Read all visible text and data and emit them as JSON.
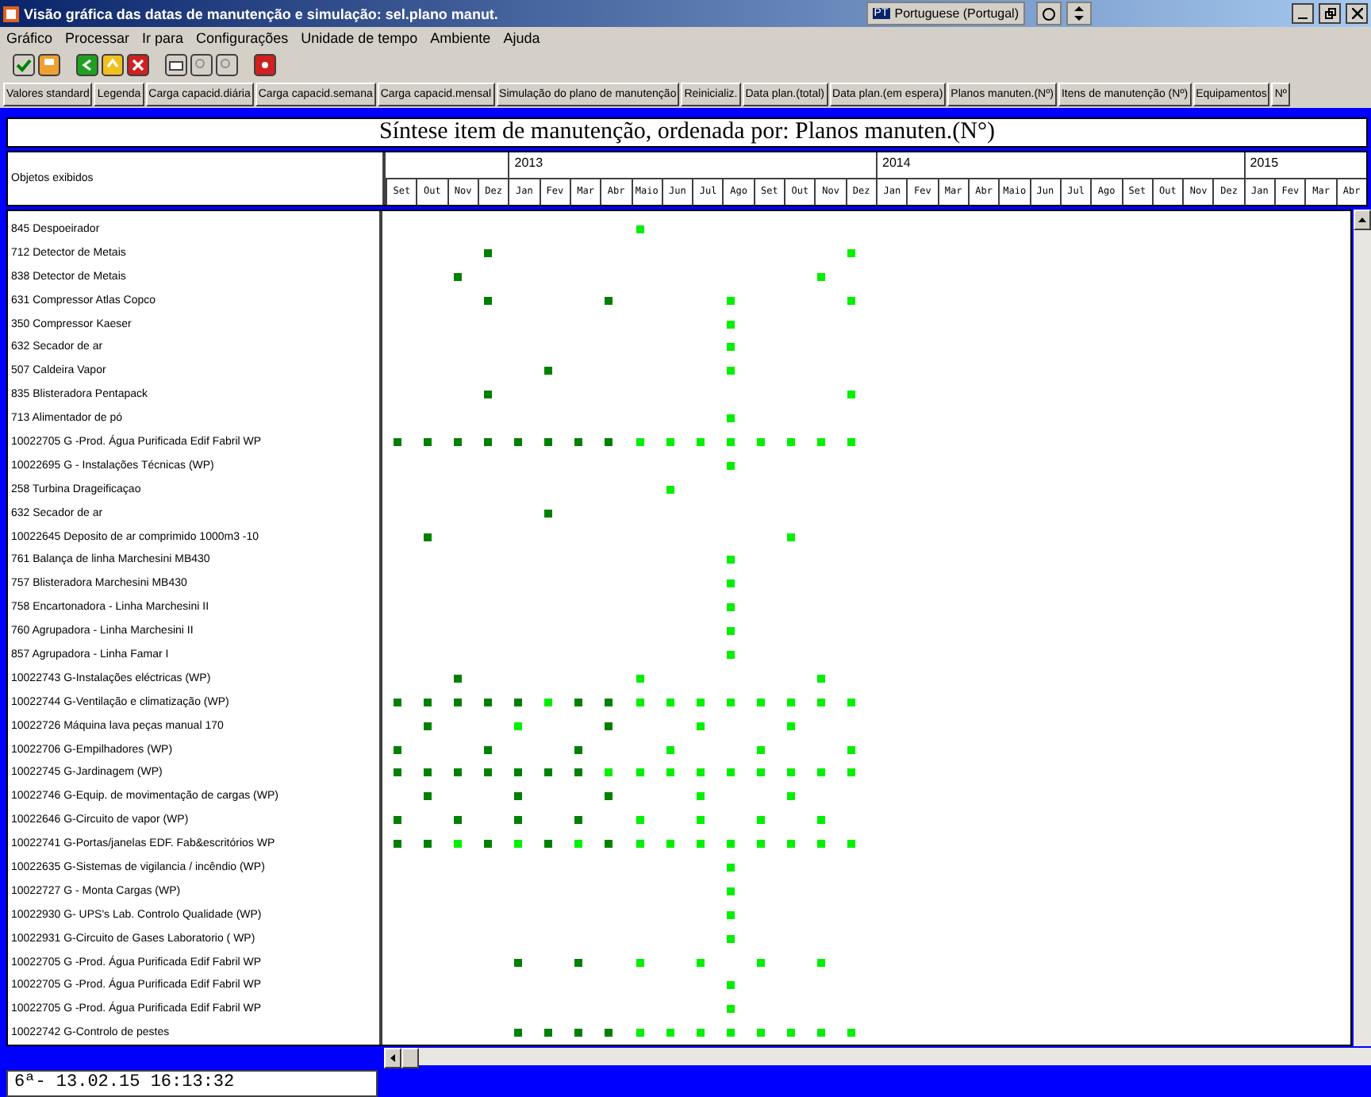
{
  "window": {
    "title": "Visão gráfica das datas de manutenção e simulação: sel.plano manut.",
    "language": "Portuguese (Portugal)",
    "language_code": "PT"
  },
  "menu": [
    "Gráfico",
    "Processar",
    "Ir para",
    "Configurações",
    "Unidade de tempo",
    "Ambiente",
    "Ajuda"
  ],
  "buttons": [
    "Valores standard",
    "Legenda",
    "Carga capacid.diária",
    "Carga capacid.semana",
    "Carga capacid.mensal",
    "Simulação do plano de manutenção",
    "Reinicializ.",
    "Data plan.(total)",
    "Data plan.(em espera)",
    "Planos manuten.(Nº)",
    "Itens de manutenção (Nº)",
    "Equipamentos",
    "Nº"
  ],
  "chart_title": "Síntese item de manutenção, ordenada por: Planos manuten.(N°)",
  "list_header": "Objetos exibidos",
  "years": [
    "2013",
    "2014",
    "2015"
  ],
  "months": [
    "Set",
    "Out",
    "Nov",
    "Dez",
    "Jan",
    "Fev",
    "Mar",
    "Abr",
    "Maio",
    "Jun",
    "Jul",
    "Ago",
    "Set",
    "Out",
    "Nov",
    "Dez",
    "Jan",
    "Fev",
    "Mar",
    "Abr",
    "Maio",
    "Jun",
    "Jul",
    "Ago",
    "Set",
    "Out",
    "Nov",
    "Dez",
    "Jan",
    "Fev",
    "Mar",
    "Abr"
  ],
  "rows": [
    {
      "name": "845 Despoeirador",
      "slots": [
        {
          "kind": "none"
        },
        {
          "kind": "none"
        },
        {
          "kind": "none"
        },
        {
          "kind": "none"
        },
        {
          "kind": "none"
        },
        {
          "kind": "none"
        },
        {
          "kind": "none"
        },
        {
          "kind": "none"
        },
        {
          "kind": "light"
        },
        {
          "kind": "none"
        },
        {
          "kind": "none"
        },
        {
          "kind": "none"
        },
        {
          "kind": "none"
        },
        {
          "kind": "none"
        },
        {
          "kind": "none"
        },
        {
          "kind": "none"
        }
      ]
    },
    {
      "name": "712 Detector de Metais",
      "slots": [
        {
          "kind": "none"
        },
        {
          "kind": "none"
        },
        {
          "kind": "none"
        },
        {
          "kind": "dark"
        },
        {
          "kind": "none"
        },
        {
          "kind": "none"
        },
        {
          "kind": "none"
        },
        {
          "kind": "none"
        },
        {
          "kind": "none"
        },
        {
          "kind": "none"
        },
        {
          "kind": "none"
        },
        {
          "kind": "none"
        },
        {
          "kind": "none"
        },
        {
          "kind": "none"
        },
        {
          "kind": "none"
        },
        {
          "kind": "light"
        }
      ]
    },
    {
      "name": "838 Detector de Metais",
      "slots": [
        {
          "kind": "none"
        },
        {
          "kind": "none"
        },
        {
          "kind": "dark"
        },
        {
          "kind": "none"
        },
        {
          "kind": "none"
        },
        {
          "kind": "none"
        },
        {
          "kind": "none"
        },
        {
          "kind": "none"
        },
        {
          "kind": "none"
        },
        {
          "kind": "none"
        },
        {
          "kind": "none"
        },
        {
          "kind": "none"
        },
        {
          "kind": "none"
        },
        {
          "kind": "none"
        },
        {
          "kind": "light"
        },
        {
          "kind": "none"
        }
      ]
    },
    {
      "name": "631 Compressor Atlas Copco",
      "slots": [
        {
          "kind": "none"
        },
        {
          "kind": "none"
        },
        {
          "kind": "none"
        },
        {
          "kind": "dark"
        },
        {
          "kind": "none"
        },
        {
          "kind": "none"
        },
        {
          "kind": "none"
        },
        {
          "kind": "dark"
        },
        {
          "kind": "none"
        },
        {
          "kind": "none"
        },
        {
          "kind": "none"
        },
        {
          "kind": "light"
        },
        {
          "kind": "none"
        },
        {
          "kind": "none"
        },
        {
          "kind": "none"
        },
        {
          "kind": "light"
        }
      ]
    },
    {
      "name": "350 Compressor Kaeser",
      "slots": [
        {
          "kind": "none"
        },
        {
          "kind": "none"
        },
        {
          "kind": "none"
        },
        {
          "kind": "none"
        },
        {
          "kind": "none"
        },
        {
          "kind": "none"
        },
        {
          "kind": "none"
        },
        {
          "kind": "none"
        },
        {
          "kind": "none"
        },
        {
          "kind": "none"
        },
        {
          "kind": "none"
        },
        {
          "kind": "light"
        },
        {
          "kind": "none"
        },
        {
          "kind": "none"
        },
        {
          "kind": "none"
        },
        {
          "kind": "none"
        }
      ]
    },
    {
      "name": "632 Secador de ar",
      "slots": [
        {
          "kind": "none"
        },
        {
          "kind": "none"
        },
        {
          "kind": "none"
        },
        {
          "kind": "none"
        },
        {
          "kind": "none"
        },
        {
          "kind": "none"
        },
        {
          "kind": "none"
        },
        {
          "kind": "none"
        },
        {
          "kind": "none"
        },
        {
          "kind": "none"
        },
        {
          "kind": "none"
        },
        {
          "kind": "light"
        },
        {
          "kind": "none"
        },
        {
          "kind": "none"
        },
        {
          "kind": "none"
        },
        {
          "kind": "none"
        }
      ]
    },
    {
      "name": "507 Caldeira Vapor",
      "slots": [
        {
          "kind": "none"
        },
        {
          "kind": "none"
        },
        {
          "kind": "none"
        },
        {
          "kind": "none"
        },
        {
          "kind": "none"
        },
        {
          "kind": "dark"
        },
        {
          "kind": "none"
        },
        {
          "kind": "none"
        },
        {
          "kind": "none"
        },
        {
          "kind": "none"
        },
        {
          "kind": "none"
        },
        {
          "kind": "light"
        },
        {
          "kind": "none"
        },
        {
          "kind": "none"
        },
        {
          "kind": "none"
        },
        {
          "kind": "none"
        }
      ]
    },
    {
      "name": "835 Blisteradora Pentapack",
      "slots": [
        {
          "kind": "none"
        },
        {
          "kind": "none"
        },
        {
          "kind": "none"
        },
        {
          "kind": "dark"
        },
        {
          "kind": "none"
        },
        {
          "kind": "none"
        },
        {
          "kind": "none"
        },
        {
          "kind": "none"
        },
        {
          "kind": "none"
        },
        {
          "kind": "none"
        },
        {
          "kind": "none"
        },
        {
          "kind": "none"
        },
        {
          "kind": "none"
        },
        {
          "kind": "none"
        },
        {
          "kind": "none"
        },
        {
          "kind": "light"
        }
      ]
    },
    {
      "name": "713 Alimentador de pó",
      "slots": [
        {
          "kind": "none"
        },
        {
          "kind": "none"
        },
        {
          "kind": "none"
        },
        {
          "kind": "none"
        },
        {
          "kind": "none"
        },
        {
          "kind": "none"
        },
        {
          "kind": "none"
        },
        {
          "kind": "none"
        },
        {
          "kind": "none"
        },
        {
          "kind": "none"
        },
        {
          "kind": "none"
        },
        {
          "kind": "light"
        },
        {
          "kind": "none"
        },
        {
          "kind": "none"
        },
        {
          "kind": "none"
        },
        {
          "kind": "none"
        }
      ]
    },
    {
      "name": "10022705 G -Prod. Água Purificada Edif Fabril WP",
      "slots": [
        {
          "kind": "dark"
        },
        {
          "kind": "dark"
        },
        {
          "kind": "dark"
        },
        {
          "kind": "dark"
        },
        {
          "kind": "dark"
        },
        {
          "kind": "dark"
        },
        {
          "kind": "dark"
        },
        {
          "kind": "dark"
        },
        {
          "kind": "light"
        },
        {
          "kind": "light"
        },
        {
          "kind": "light"
        },
        {
          "kind": "light"
        },
        {
          "kind": "light"
        },
        {
          "kind": "light"
        },
        {
          "kind": "light"
        },
        {
          "kind": "light"
        }
      ]
    },
    {
      "name": "10022695 G - Instalações Técnicas (WP)",
      "slots": [
        {
          "kind": "none"
        },
        {
          "kind": "none"
        },
        {
          "kind": "none"
        },
        {
          "kind": "none"
        },
        {
          "kind": "none"
        },
        {
          "kind": "none"
        },
        {
          "kind": "none"
        },
        {
          "kind": "none"
        },
        {
          "kind": "none"
        },
        {
          "kind": "none"
        },
        {
          "kind": "none"
        },
        {
          "kind": "light"
        },
        {
          "kind": "none"
        },
        {
          "kind": "none"
        },
        {
          "kind": "none"
        },
        {
          "kind": "none"
        }
      ]
    },
    {
      "name": "258 Turbina Drageificaçao",
      "slots": [
        {
          "kind": "none"
        },
        {
          "kind": "none"
        },
        {
          "kind": "none"
        },
        {
          "kind": "none"
        },
        {
          "kind": "none"
        },
        {
          "kind": "none"
        },
        {
          "kind": "none"
        },
        {
          "kind": "none"
        },
        {
          "kind": "none"
        },
        {
          "kind": "light"
        },
        {
          "kind": "none"
        },
        {
          "kind": "none"
        },
        {
          "kind": "none"
        },
        {
          "kind": "none"
        },
        {
          "kind": "none"
        },
        {
          "kind": "none"
        }
      ]
    },
    {
      "name": "632 Secador de ar",
      "slots": [
        {
          "kind": "none"
        },
        {
          "kind": "none"
        },
        {
          "kind": "none"
        },
        {
          "kind": "none"
        },
        {
          "kind": "none"
        },
        {
          "kind": "dark"
        },
        {
          "kind": "none"
        },
        {
          "kind": "none"
        },
        {
          "kind": "none"
        },
        {
          "kind": "none"
        },
        {
          "kind": "none"
        },
        {
          "kind": "none"
        },
        {
          "kind": "none"
        },
        {
          "kind": "none"
        },
        {
          "kind": "none"
        },
        {
          "kind": "none"
        }
      ]
    },
    {
      "name": "10022645 Deposito de ar comprimido 1000m3 -10",
      "slots": [
        {
          "kind": "none"
        },
        {
          "kind": "dark"
        },
        {
          "kind": "none"
        },
        {
          "kind": "none"
        },
        {
          "kind": "none"
        },
        {
          "kind": "none"
        },
        {
          "kind": "none"
        },
        {
          "kind": "none"
        },
        {
          "kind": "none"
        },
        {
          "kind": "none"
        },
        {
          "kind": "none"
        },
        {
          "kind": "none"
        },
        {
          "kind": "none"
        },
        {
          "kind": "light"
        },
        {
          "kind": "none"
        },
        {
          "kind": "none"
        }
      ]
    },
    {
      "name": "761 Balança de linha Marchesini MB430",
      "slots": [
        {
          "kind": "none"
        },
        {
          "kind": "none"
        },
        {
          "kind": "none"
        },
        {
          "kind": "none"
        },
        {
          "kind": "none"
        },
        {
          "kind": "none"
        },
        {
          "kind": "none"
        },
        {
          "kind": "none"
        },
        {
          "kind": "none"
        },
        {
          "kind": "none"
        },
        {
          "kind": "none"
        },
        {
          "kind": "light"
        },
        {
          "kind": "none"
        },
        {
          "kind": "none"
        },
        {
          "kind": "none"
        },
        {
          "kind": "none"
        }
      ]
    },
    {
      "name": "757 Blisteradora Marchesini MB430",
      "slots": [
        {
          "kind": "none"
        },
        {
          "kind": "none"
        },
        {
          "kind": "none"
        },
        {
          "kind": "none"
        },
        {
          "kind": "none"
        },
        {
          "kind": "none"
        },
        {
          "kind": "none"
        },
        {
          "kind": "none"
        },
        {
          "kind": "none"
        },
        {
          "kind": "none"
        },
        {
          "kind": "none"
        },
        {
          "kind": "light"
        },
        {
          "kind": "none"
        },
        {
          "kind": "none"
        },
        {
          "kind": "none"
        },
        {
          "kind": "none"
        }
      ]
    },
    {
      "name": "758 Encartonadora - Linha Marchesini II",
      "slots": [
        {
          "kind": "none"
        },
        {
          "kind": "none"
        },
        {
          "kind": "none"
        },
        {
          "kind": "none"
        },
        {
          "kind": "none"
        },
        {
          "kind": "none"
        },
        {
          "kind": "none"
        },
        {
          "kind": "none"
        },
        {
          "kind": "none"
        },
        {
          "kind": "none"
        },
        {
          "kind": "none"
        },
        {
          "kind": "light"
        },
        {
          "kind": "none"
        },
        {
          "kind": "none"
        },
        {
          "kind": "none"
        },
        {
          "kind": "none"
        }
      ]
    },
    {
      "name": "760 Agrupadora - Linha Marchesini II",
      "slots": [
        {
          "kind": "none"
        },
        {
          "kind": "none"
        },
        {
          "kind": "none"
        },
        {
          "kind": "none"
        },
        {
          "kind": "none"
        },
        {
          "kind": "none"
        },
        {
          "kind": "none"
        },
        {
          "kind": "none"
        },
        {
          "kind": "none"
        },
        {
          "kind": "none"
        },
        {
          "kind": "none"
        },
        {
          "kind": "light"
        },
        {
          "kind": "none"
        },
        {
          "kind": "none"
        },
        {
          "kind": "none"
        },
        {
          "kind": "none"
        }
      ]
    },
    {
      "name": "857 Agrupadora - Linha Famar I",
      "slots": [
        {
          "kind": "none"
        },
        {
          "kind": "none"
        },
        {
          "kind": "none"
        },
        {
          "kind": "none"
        },
        {
          "kind": "none"
        },
        {
          "kind": "none"
        },
        {
          "kind": "none"
        },
        {
          "kind": "none"
        },
        {
          "kind": "none"
        },
        {
          "kind": "none"
        },
        {
          "kind": "none"
        },
        {
          "kind": "light"
        },
        {
          "kind": "none"
        },
        {
          "kind": "none"
        },
        {
          "kind": "none"
        },
        {
          "kind": "none"
        }
      ]
    },
    {
      "name": "10022743 G-Instalações eléctricas (WP)",
      "slots": [
        {
          "kind": "none"
        },
        {
          "kind": "none"
        },
        {
          "kind": "dark"
        },
        {
          "kind": "none"
        },
        {
          "kind": "none"
        },
        {
          "kind": "none"
        },
        {
          "kind": "none"
        },
        {
          "kind": "none"
        },
        {
          "kind": "light"
        },
        {
          "kind": "none"
        },
        {
          "kind": "none"
        },
        {
          "kind": "none"
        },
        {
          "kind": "none"
        },
        {
          "kind": "none"
        },
        {
          "kind": "light"
        },
        {
          "kind": "none"
        }
      ]
    },
    {
      "name": "10022744 G-Ventilação e climatização (WP)",
      "slots": [
        {
          "kind": "dark"
        },
        {
          "kind": "dark"
        },
        {
          "kind": "dark"
        },
        {
          "kind": "dark"
        },
        {
          "kind": "dark"
        },
        {
          "kind": "light"
        },
        {
          "kind": "dark"
        },
        {
          "kind": "dark"
        },
        {
          "kind": "light"
        },
        {
          "kind": "light"
        },
        {
          "kind": "light"
        },
        {
          "kind": "light"
        },
        {
          "kind": "light"
        },
        {
          "kind": "light"
        },
        {
          "kind": "light"
        },
        {
          "kind": "light"
        }
      ]
    },
    {
      "name": "10022726 Máquina lava peças manual 170",
      "slots": [
        {
          "kind": "none"
        },
        {
          "kind": "dark"
        },
        {
          "kind": "none"
        },
        {
          "kind": "none"
        },
        {
          "kind": "light"
        },
        {
          "kind": "none"
        },
        {
          "kind": "none"
        },
        {
          "kind": "dark"
        },
        {
          "kind": "none"
        },
        {
          "kind": "none"
        },
        {
          "kind": "light"
        },
        {
          "kind": "none"
        },
        {
          "kind": "none"
        },
        {
          "kind": "light"
        },
        {
          "kind": "none"
        },
        {
          "kind": "none"
        }
      ]
    },
    {
      "name": "10022706 G-Empilhadores (WP)",
      "slots": [
        {
          "kind": "dark"
        },
        {
          "kind": "none"
        },
        {
          "kind": "none"
        },
        {
          "kind": "dark"
        },
        {
          "kind": "none"
        },
        {
          "kind": "none"
        },
        {
          "kind": "dark"
        },
        {
          "kind": "none"
        },
        {
          "kind": "none"
        },
        {
          "kind": "light"
        },
        {
          "kind": "none"
        },
        {
          "kind": "none"
        },
        {
          "kind": "light"
        },
        {
          "kind": "none"
        },
        {
          "kind": "none"
        },
        {
          "kind": "light"
        }
      ]
    },
    {
      "name": "10022745 G-Jardinagem (WP)",
      "slots": [
        {
          "kind": "dark"
        },
        {
          "kind": "dark"
        },
        {
          "kind": "dark"
        },
        {
          "kind": "dark"
        },
        {
          "kind": "dark"
        },
        {
          "kind": "dark"
        },
        {
          "kind": "dark"
        },
        {
          "kind": "light"
        },
        {
          "kind": "light"
        },
        {
          "kind": "light"
        },
        {
          "kind": "light"
        },
        {
          "kind": "light"
        },
        {
          "kind": "light"
        },
        {
          "kind": "light"
        },
        {
          "kind": "light"
        },
        {
          "kind": "light"
        }
      ]
    },
    {
      "name": "10022746 G-Equip. de movimentação de cargas (WP)",
      "slots": [
        {
          "kind": "none"
        },
        {
          "kind": "dark"
        },
        {
          "kind": "none"
        },
        {
          "kind": "none"
        },
        {
          "kind": "dark"
        },
        {
          "kind": "none"
        },
        {
          "kind": "none"
        },
        {
          "kind": "dark"
        },
        {
          "kind": "none"
        },
        {
          "kind": "none"
        },
        {
          "kind": "light"
        },
        {
          "kind": "none"
        },
        {
          "kind": "none"
        },
        {
          "kind": "light"
        },
        {
          "kind": "none"
        },
        {
          "kind": "none"
        }
      ]
    },
    {
      "name": "10022646 G-Circuito de vapor (WP)",
      "slots": [
        {
          "kind": "dark"
        },
        {
          "kind": "none"
        },
        {
          "kind": "dark"
        },
        {
          "kind": "none"
        },
        {
          "kind": "dark"
        },
        {
          "kind": "none"
        },
        {
          "kind": "dark"
        },
        {
          "kind": "none"
        },
        {
          "kind": "light"
        },
        {
          "kind": "none"
        },
        {
          "kind": "light"
        },
        {
          "kind": "none"
        },
        {
          "kind": "light"
        },
        {
          "kind": "none"
        },
        {
          "kind": "light"
        },
        {
          "kind": "none"
        }
      ]
    },
    {
      "name": "10022741 G-Portas/janelas EDF. Fab&escritórios WP",
      "slots": [
        {
          "kind": "dark"
        },
        {
          "kind": "dark"
        },
        {
          "kind": "light"
        },
        {
          "kind": "dark"
        },
        {
          "kind": "light"
        },
        {
          "kind": "dark"
        },
        {
          "kind": "light"
        },
        {
          "kind": "dark"
        },
        {
          "kind": "light"
        },
        {
          "kind": "light"
        },
        {
          "kind": "light"
        },
        {
          "kind": "light"
        },
        {
          "kind": "light"
        },
        {
          "kind": "light"
        },
        {
          "kind": "light"
        },
        {
          "kind": "light"
        }
      ]
    },
    {
      "name": "10022635 G-Sistemas de vigilancia / incêndio (WP)",
      "slots": [
        {
          "kind": "none"
        },
        {
          "kind": "none"
        },
        {
          "kind": "none"
        },
        {
          "kind": "none"
        },
        {
          "kind": "none"
        },
        {
          "kind": "none"
        },
        {
          "kind": "none"
        },
        {
          "kind": "none"
        },
        {
          "kind": "none"
        },
        {
          "kind": "none"
        },
        {
          "kind": "none"
        },
        {
          "kind": "light"
        },
        {
          "kind": "none"
        },
        {
          "kind": "none"
        },
        {
          "kind": "none"
        },
        {
          "kind": "none"
        }
      ]
    },
    {
      "name": "10022727 G - Monta Cargas (WP)",
      "slots": [
        {
          "kind": "none"
        },
        {
          "kind": "none"
        },
        {
          "kind": "none"
        },
        {
          "kind": "none"
        },
        {
          "kind": "none"
        },
        {
          "kind": "none"
        },
        {
          "kind": "none"
        },
        {
          "kind": "none"
        },
        {
          "kind": "none"
        },
        {
          "kind": "none"
        },
        {
          "kind": "none"
        },
        {
          "kind": "light"
        },
        {
          "kind": "none"
        },
        {
          "kind": "none"
        },
        {
          "kind": "none"
        },
        {
          "kind": "none"
        }
      ]
    },
    {
      "name": "10022930 G- UPS's Lab. Controlo Qualidade (WP)",
      "slots": [
        {
          "kind": "none"
        },
        {
          "kind": "none"
        },
        {
          "kind": "none"
        },
        {
          "kind": "none"
        },
        {
          "kind": "none"
        },
        {
          "kind": "none"
        },
        {
          "kind": "none"
        },
        {
          "kind": "none"
        },
        {
          "kind": "none"
        },
        {
          "kind": "none"
        },
        {
          "kind": "none"
        },
        {
          "kind": "light"
        },
        {
          "kind": "none"
        },
        {
          "kind": "none"
        },
        {
          "kind": "none"
        },
        {
          "kind": "none"
        }
      ]
    },
    {
      "name": "10022931 G-Circuito de Gases Laboratorio ( WP)",
      "slots": [
        {
          "kind": "none"
        },
        {
          "kind": "none"
        },
        {
          "kind": "none"
        },
        {
          "kind": "none"
        },
        {
          "kind": "none"
        },
        {
          "kind": "none"
        },
        {
          "kind": "none"
        },
        {
          "kind": "none"
        },
        {
          "kind": "none"
        },
        {
          "kind": "none"
        },
        {
          "kind": "none"
        },
        {
          "kind": "light"
        },
        {
          "kind": "none"
        },
        {
          "kind": "none"
        },
        {
          "kind": "none"
        },
        {
          "kind": "none"
        }
      ]
    },
    {
      "name": "10022705 G -Prod. Água Purificada Edif Fabril WP",
      "slots": [
        {
          "kind": "none"
        },
        {
          "kind": "none"
        },
        {
          "kind": "none"
        },
        {
          "kind": "none"
        },
        {
          "kind": "dark"
        },
        {
          "kind": "none"
        },
        {
          "kind": "dark"
        },
        {
          "kind": "none"
        },
        {
          "kind": "light"
        },
        {
          "kind": "none"
        },
        {
          "kind": "light"
        },
        {
          "kind": "none"
        },
        {
          "kind": "light"
        },
        {
          "kind": "none"
        },
        {
          "kind": "light"
        },
        {
          "kind": "none"
        }
      ]
    },
    {
      "name": "10022705 G -Prod. Água Purificada Edif Fabril WP",
      "slots": [
        {
          "kind": "none"
        },
        {
          "kind": "none"
        },
        {
          "kind": "none"
        },
        {
          "kind": "none"
        },
        {
          "kind": "none"
        },
        {
          "kind": "none"
        },
        {
          "kind": "none"
        },
        {
          "kind": "none"
        },
        {
          "kind": "none"
        },
        {
          "kind": "none"
        },
        {
          "kind": "none"
        },
        {
          "kind": "light"
        },
        {
          "kind": "none"
        },
        {
          "kind": "none"
        },
        {
          "kind": "none"
        },
        {
          "kind": "none"
        }
      ]
    },
    {
      "name": "10022705 G -Prod. Água Purificada Edif Fabril WP",
      "slots": [
        {
          "kind": "none"
        },
        {
          "kind": "none"
        },
        {
          "kind": "none"
        },
        {
          "kind": "none"
        },
        {
          "kind": "none"
        },
        {
          "kind": "none"
        },
        {
          "kind": "none"
        },
        {
          "kind": "none"
        },
        {
          "kind": "none"
        },
        {
          "kind": "none"
        },
        {
          "kind": "none"
        },
        {
          "kind": "light"
        },
        {
          "kind": "none"
        },
        {
          "kind": "none"
        },
        {
          "kind": "none"
        },
        {
          "kind": "none"
        }
      ]
    },
    {
      "name": "10022742 G-Controlo de pestes",
      "slots": [
        {
          "kind": "none"
        },
        {
          "kind": "none"
        },
        {
          "kind": "none"
        },
        {
          "kind": "none"
        },
        {
          "kind": "dark"
        },
        {
          "kind": "dark"
        },
        {
          "kind": "dark"
        },
        {
          "kind": "dark"
        },
        {
          "kind": "light"
        },
        {
          "kind": "light"
        },
        {
          "kind": "light"
        },
        {
          "kind": "light"
        },
        {
          "kind": "light"
        },
        {
          "kind": "light"
        },
        {
          "kind": "light"
        },
        {
          "kind": "light"
        }
      ]
    }
  ],
  "status": "6ª- 13.02.15 16:13:32"
}
